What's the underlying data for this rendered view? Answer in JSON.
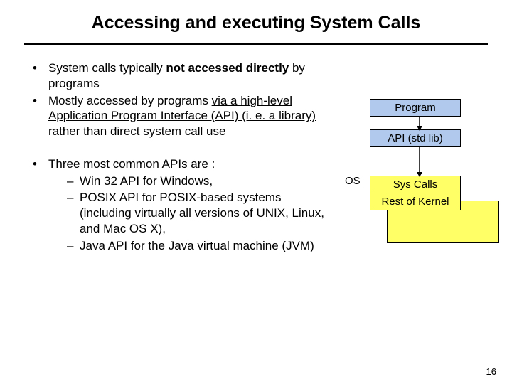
{
  "title": "Accessing and executing System Calls",
  "bullets": {
    "b1_pre": "System calls typically ",
    "b1_bold": "not accessed directly",
    "b1_post": " by programs",
    "b2_pre": "Mostly accessed by programs ",
    "b2_u": "via a high-level Application Program Interface (API) (i. e. a library)",
    "b2_post": " rather than direct system call use",
    "b3": "Three most common APIs are :"
  },
  "sub": {
    "s1": "Win 32 API for Windows,",
    "s2": "POSIX API for POSIX-based systems (including virtually all versions of UNIX, Linux, and Mac OS X),",
    "s3": "Java API for the Java virtual machine (JVM)"
  },
  "diagram": {
    "program": "Program",
    "api": "API (std lib)",
    "os": "OS",
    "sys": "Sys Calls",
    "rest": "Rest of Kernel"
  },
  "page": "16"
}
